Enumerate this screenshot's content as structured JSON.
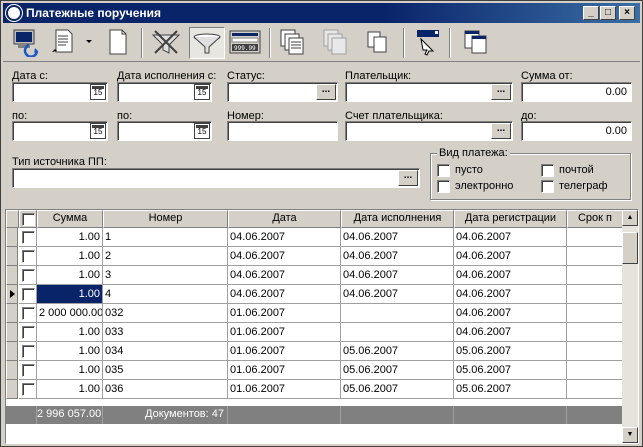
{
  "window": {
    "title": "Платежные поручения"
  },
  "toolbar": {
    "buttons": [
      "refresh-icon",
      "edit-document-icon",
      "dropdown-arrow-icon",
      "new-document-icon",
      "clear-filter-icon",
      "filter-icon",
      "calculator-icon",
      "print-icon",
      "print-preview-icon",
      "copy-icon",
      "export-icon",
      "windows-icon"
    ]
  },
  "filters": {
    "date_from_label": "Дата с:",
    "date_from_value": "",
    "exec_date_from_label": "Дата исполнения с:",
    "exec_date_from_value": "",
    "status_label": "Статус:",
    "status_value": "",
    "payer_label": "Плательщик:",
    "payer_value": "",
    "sum_from_label": "Сумма от:",
    "sum_from_value": "0.00",
    "date_to_label": "по:",
    "date_to_value": "",
    "exec_date_to_label": "по:",
    "exec_date_to_value": "",
    "number_label": "Номер:",
    "number_value": "",
    "payer_account_label": "Счет плательщика:",
    "payer_account_value": "",
    "sum_to_label": "до:",
    "sum_to_value": "0.00",
    "source_type_label": "Тип источника ПП:",
    "source_type_value": "",
    "calendar_button": "15",
    "ellipsis_button": "..."
  },
  "payment_type": {
    "title": "Вид платежа:",
    "options": [
      "пусто",
      "электронно",
      "почтой",
      "телеграф"
    ]
  },
  "grid": {
    "columns": [
      "Сумма",
      "Номер",
      "Дата",
      "Дата исполнения",
      "Дата регистрации",
      "Срок п"
    ],
    "rows": [
      {
        "sum": "1.00",
        "number": "1",
        "date": "04.06.2007",
        "exec_date": "04.06.2007",
        "reg_date": "04.06.2007"
      },
      {
        "sum": "1.00",
        "number": "2",
        "date": "04.06.2007",
        "exec_date": "04.06.2007",
        "reg_date": "04.06.2007"
      },
      {
        "sum": "1.00",
        "number": "3",
        "date": "04.06.2007",
        "exec_date": "04.06.2007",
        "reg_date": "04.06.2007"
      },
      {
        "sum": "1.00",
        "number": "4",
        "date": "04.06.2007",
        "exec_date": "04.06.2007",
        "reg_date": "04.06.2007"
      },
      {
        "sum": "2 000 000.00",
        "number": "032",
        "date": "01.06.2007",
        "exec_date": "",
        "reg_date": "04.06.2007"
      },
      {
        "sum": "1.00",
        "number": "033",
        "date": "01.06.2007",
        "exec_date": "",
        "reg_date": "04.06.2007"
      },
      {
        "sum": "1.00",
        "number": "034",
        "date": "01.06.2007",
        "exec_date": "05.06.2007",
        "reg_date": "05.06.2007"
      },
      {
        "sum": "1.00",
        "number": "035",
        "date": "01.06.2007",
        "exec_date": "05.06.2007",
        "reg_date": "05.06.2007"
      },
      {
        "sum": "1.00",
        "number": "036",
        "date": "01.06.2007",
        "exec_date": "05.06.2007",
        "reg_date": "05.06.2007"
      }
    ],
    "total_sum": "2 996 057.00",
    "documents_label": "Документов: 47"
  }
}
